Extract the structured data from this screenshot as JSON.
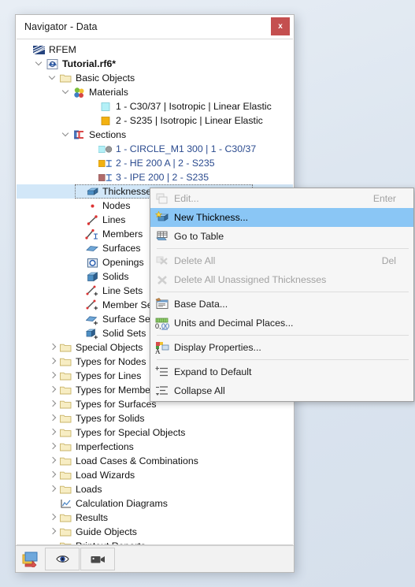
{
  "window": {
    "title": "Navigator - Data",
    "close_label": "x"
  },
  "tree": {
    "items": [
      {
        "label": "RFEM",
        "indent": 0,
        "arrow": "none",
        "icon": "rfem-logo-icon",
        "bold": false,
        "selected": false
      },
      {
        "label": "Tutorial.rf6*",
        "indent": 1,
        "arrow": "open",
        "icon": "model-icon",
        "bold": true,
        "selected": false
      },
      {
        "label": "Basic Objects",
        "indent": 2,
        "arrow": "open",
        "icon": "folder-icon",
        "bold": false,
        "selected": false
      },
      {
        "label": "Materials",
        "indent": 3,
        "arrow": "open",
        "icon": "materials-icon",
        "bold": false,
        "selected": false
      },
      {
        "label": "1 - C30/37 | Isotropic | Linear Elastic",
        "indent": 5,
        "arrow": "none",
        "icon": "swatch-cyan-icon",
        "bold": false,
        "selected": false
      },
      {
        "label": "2 - S235 | Isotropic | Linear Elastic",
        "indent": 5,
        "arrow": "none",
        "icon": "swatch-amber-icon",
        "bold": false,
        "selected": false
      },
      {
        "label": "Sections",
        "indent": 3,
        "arrow": "open",
        "icon": "sections-icon",
        "bold": false,
        "selected": false
      },
      {
        "label": "1 - CIRCLE_M1 300 | 1 - C30/37",
        "indent": 5,
        "arrow": "none",
        "icon": "section-circle-icon",
        "bold": false,
        "selected": false,
        "link": true
      },
      {
        "label": "2 - HE 200 A | 2 - S235",
        "indent": 5,
        "arrow": "none",
        "icon": "section-i-amber-icon",
        "bold": false,
        "selected": false,
        "link": true
      },
      {
        "label": "3 - IPE 200 | 2 - S235",
        "indent": 5,
        "arrow": "none",
        "icon": "section-i-rose-icon",
        "bold": false,
        "selected": false,
        "link": true
      },
      {
        "label": "Thicknesses",
        "indent": 4,
        "arrow": "none",
        "icon": "thickness-icon",
        "bold": false,
        "selected": true
      },
      {
        "label": "Nodes",
        "indent": 4,
        "arrow": "none",
        "icon": "nodes-icon",
        "bold": false,
        "selected": false
      },
      {
        "label": "Lines",
        "indent": 4,
        "arrow": "none",
        "icon": "lines-icon",
        "bold": false,
        "selected": false
      },
      {
        "label": "Members",
        "indent": 4,
        "arrow": "none",
        "icon": "members-icon",
        "bold": false,
        "selected": false
      },
      {
        "label": "Surfaces",
        "indent": 4,
        "arrow": "none",
        "icon": "surfaces-icon",
        "bold": false,
        "selected": false
      },
      {
        "label": "Openings",
        "indent": 4,
        "arrow": "none",
        "icon": "openings-icon",
        "bold": false,
        "selected": false
      },
      {
        "label": "Solids",
        "indent": 4,
        "arrow": "none",
        "icon": "solids-icon",
        "bold": false,
        "selected": false
      },
      {
        "label": "Line Sets",
        "indent": 4,
        "arrow": "none",
        "icon": "line-sets-icon",
        "bold": false,
        "selected": false
      },
      {
        "label": "Member Sets",
        "indent": 4,
        "arrow": "none",
        "icon": "member-sets-icon",
        "bold": false,
        "selected": false
      },
      {
        "label": "Surface Sets",
        "indent": 4,
        "arrow": "none",
        "icon": "surface-sets-icon",
        "bold": false,
        "selected": false
      },
      {
        "label": "Solid Sets",
        "indent": 4,
        "arrow": "none",
        "icon": "solid-sets-icon",
        "bold": false,
        "selected": false
      },
      {
        "label": "Special Objects",
        "indent": 2,
        "arrow": "closed",
        "icon": "folder-icon",
        "bold": false,
        "selected": false
      },
      {
        "label": "Types for Nodes",
        "indent": 2,
        "arrow": "closed",
        "icon": "folder-icon",
        "bold": false,
        "selected": false
      },
      {
        "label": "Types for Lines",
        "indent": 2,
        "arrow": "closed",
        "icon": "folder-icon",
        "bold": false,
        "selected": false
      },
      {
        "label": "Types for Members",
        "indent": 2,
        "arrow": "closed",
        "icon": "folder-icon",
        "bold": false,
        "selected": false
      },
      {
        "label": "Types for Surfaces",
        "indent": 2,
        "arrow": "closed",
        "icon": "folder-icon",
        "bold": false,
        "selected": false
      },
      {
        "label": "Types for Solids",
        "indent": 2,
        "arrow": "closed",
        "icon": "folder-icon",
        "bold": false,
        "selected": false
      },
      {
        "label": "Types for Special Objects",
        "indent": 2,
        "arrow": "closed",
        "icon": "folder-icon",
        "bold": false,
        "selected": false
      },
      {
        "label": "Imperfections",
        "indent": 2,
        "arrow": "closed",
        "icon": "folder-icon",
        "bold": false,
        "selected": false
      },
      {
        "label": "Load Cases & Combinations",
        "indent": 2,
        "arrow": "closed",
        "icon": "folder-icon",
        "bold": false,
        "selected": false
      },
      {
        "label": "Load Wizards",
        "indent": 2,
        "arrow": "closed",
        "icon": "folder-icon",
        "bold": false,
        "selected": false
      },
      {
        "label": "Loads",
        "indent": 2,
        "arrow": "closed",
        "icon": "folder-icon",
        "bold": false,
        "selected": false
      },
      {
        "label": "Calculation Diagrams",
        "indent": 2,
        "arrow": "none",
        "icon": "diagram-icon",
        "bold": false,
        "selected": false
      },
      {
        "label": "Results",
        "indent": 2,
        "arrow": "closed",
        "icon": "folder-icon",
        "bold": false,
        "selected": false
      },
      {
        "label": "Guide Objects",
        "indent": 2,
        "arrow": "closed",
        "icon": "folder-icon",
        "bold": false,
        "selected": false
      },
      {
        "label": "Printout Reports",
        "indent": 2,
        "arrow": "none",
        "icon": "folder-icon",
        "bold": false,
        "selected": false
      }
    ]
  },
  "context_menu": {
    "items": [
      {
        "type": "item",
        "label": "Edit...",
        "shortcut": "Enter",
        "icon": "edit-icon",
        "disabled": true,
        "highlighted": false
      },
      {
        "type": "item",
        "label": "New Thickness...",
        "shortcut": "",
        "icon": "new-thickness-icon",
        "disabled": false,
        "highlighted": true
      },
      {
        "type": "item",
        "label": "Go to Table",
        "shortcut": "",
        "icon": "go-to-table-icon",
        "disabled": false,
        "highlighted": false
      },
      {
        "type": "sep"
      },
      {
        "type": "item",
        "label": "Delete All",
        "shortcut": "Del",
        "icon": "delete-all-icon",
        "disabled": true,
        "highlighted": false
      },
      {
        "type": "item",
        "label": "Delete All Unassigned Thicknesses",
        "shortcut": "",
        "icon": "delete-unassigned-icon",
        "disabled": true,
        "highlighted": false
      },
      {
        "type": "sep"
      },
      {
        "type": "item",
        "label": "Base Data...",
        "shortcut": "",
        "icon": "base-data-icon",
        "disabled": false,
        "highlighted": false
      },
      {
        "type": "item",
        "label": "Units and Decimal Places...",
        "shortcut": "",
        "icon": "units-decimals-icon",
        "disabled": false,
        "highlighted": false
      },
      {
        "type": "sep"
      },
      {
        "type": "item",
        "label": "Display Properties...",
        "shortcut": "",
        "icon": "display-properties-icon",
        "disabled": false,
        "highlighted": false
      },
      {
        "type": "sep"
      },
      {
        "type": "item",
        "label": "Expand to Default",
        "shortcut": "",
        "icon": "expand-default-icon",
        "disabled": false,
        "highlighted": false
      },
      {
        "type": "item",
        "label": "Collapse All",
        "shortcut": "",
        "icon": "collapse-all-icon",
        "disabled": false,
        "highlighted": false
      }
    ]
  },
  "toolbar": {
    "corner_icon": "navigator-corner-icon",
    "buttons": [
      {
        "icon": "eye-visibility-icon",
        "label": ""
      },
      {
        "icon": "camera-icon",
        "label": ""
      }
    ]
  },
  "colors": {
    "accent_highlight": "#8ac6f5",
    "selection": "#d2e7f8",
    "close_button": "#c44f4f",
    "link_text": "#2b4b8f",
    "folder": "#f6e9b8",
    "material_cyan": "#b8f0f5",
    "material_amber": "#f0b429",
    "section_rose": "#b06b6b"
  }
}
